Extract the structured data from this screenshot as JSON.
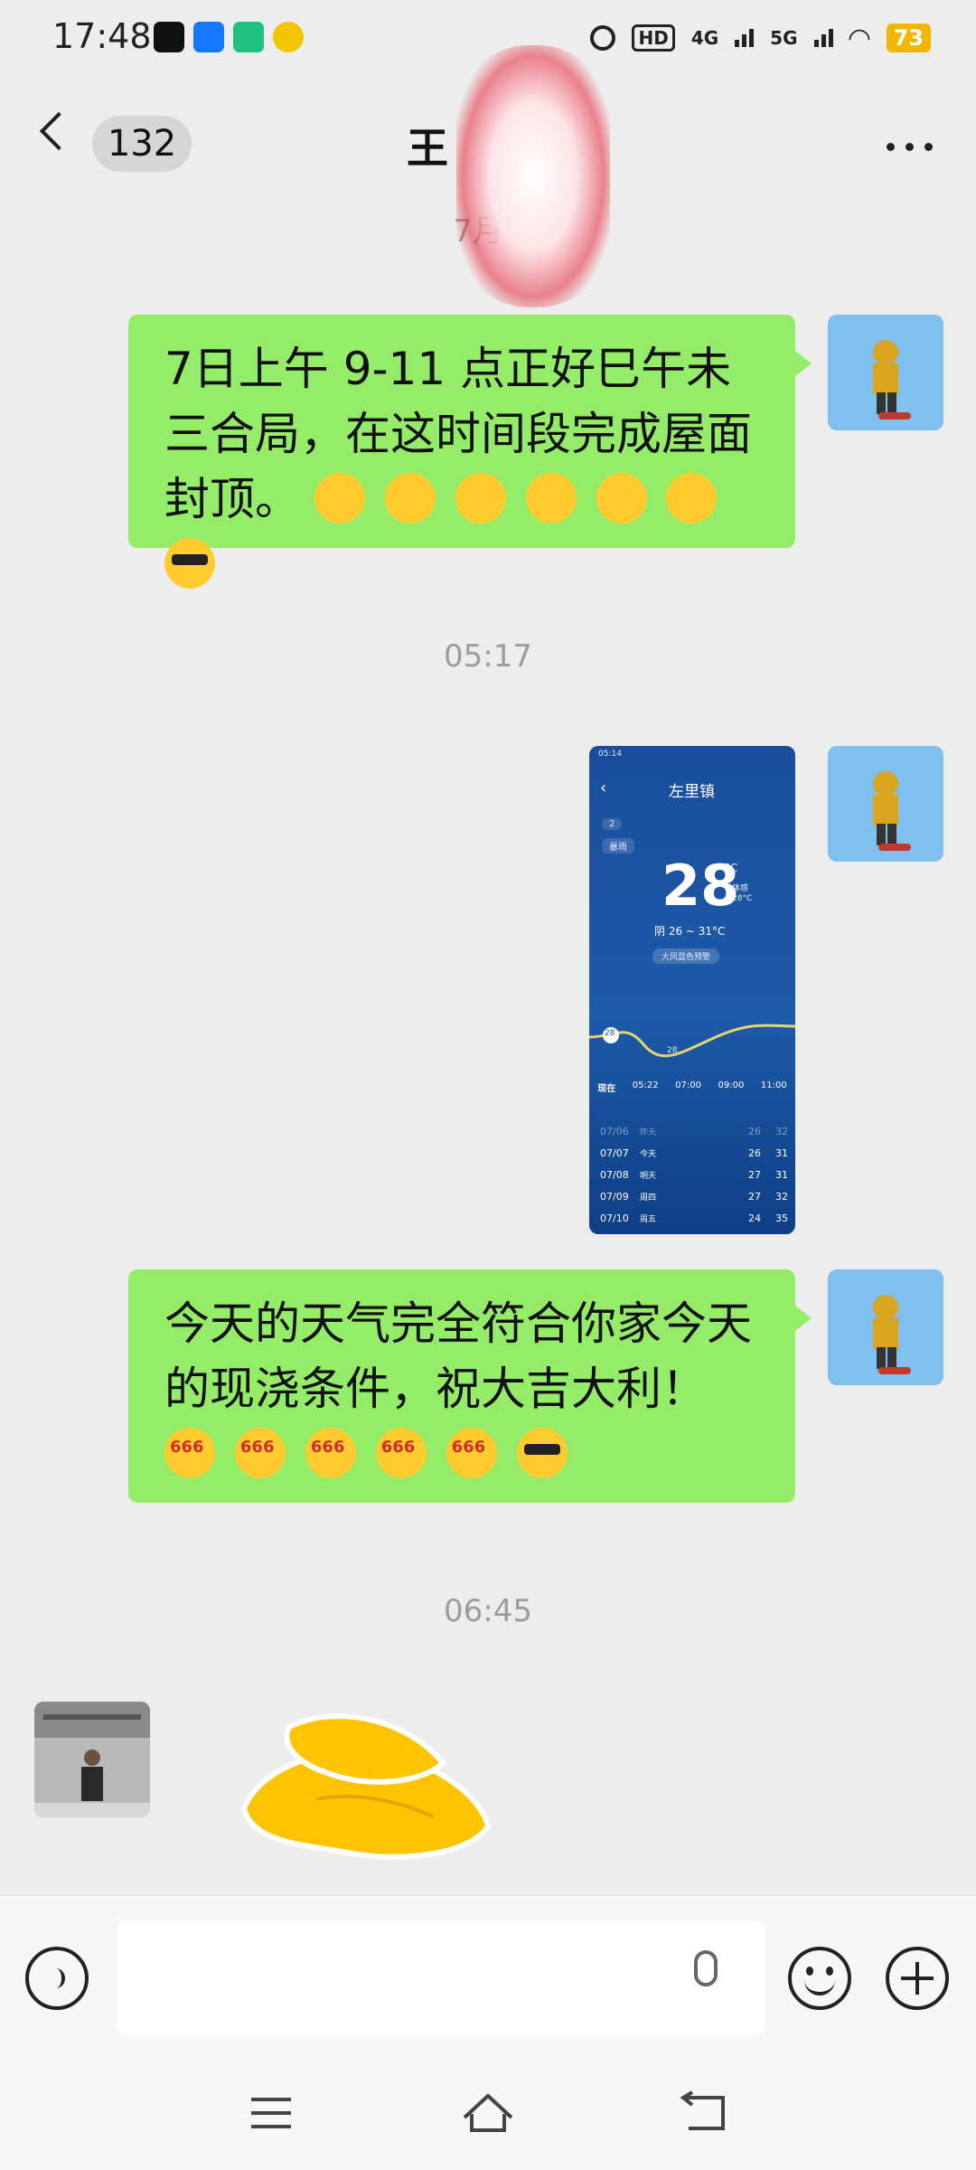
{
  "status_bar": {
    "time": "17:48",
    "network_1": "4G",
    "network_2": "5G",
    "battery": "73",
    "hd_label": "HD"
  },
  "header": {
    "unread_count": "132",
    "title": "王"
  },
  "messages": [
    {
      "type": "timestamp",
      "text": "7月4"
    },
    {
      "type": "text",
      "from": "me",
      "text": "7日上午 9-11 点正好巳午未三合局，在这时间段完成屋面封顶。"
    },
    {
      "type": "timestamp",
      "text": "05:17"
    },
    {
      "type": "image",
      "from": "me"
    },
    {
      "type": "text",
      "from": "me",
      "text": "今天的天气完全符合你家今天的现浇条件，祝大吉大利！"
    },
    {
      "type": "timestamp",
      "text": "06:45"
    },
    {
      "type": "sticker",
      "from": "other"
    }
  ],
  "weather_screenshot": {
    "status_time": "05:14",
    "location": "左里镇",
    "chip_1": "2",
    "chip_2": "暴雨",
    "temp": "28",
    "unit": "°C",
    "feels_label": "体感",
    "feels_value": "28°C",
    "condition": "阴  26 ~ 31°C",
    "alert": "大风蓝色预警",
    "curve_label_1": "28",
    "curve_label_2": "28",
    "hours": [
      "现在",
      "05:22",
      "07:00",
      "09:00",
      "11:00"
    ],
    "days": [
      {
        "date": "07/06",
        "day": "昨天",
        "low": "26",
        "high": "32"
      },
      {
        "date": "07/07",
        "day": "今天",
        "low": "26",
        "high": "31"
      },
      {
        "date": "07/08",
        "day": "明天",
        "low": "27",
        "high": "31"
      },
      {
        "date": "07/09",
        "day": "周四",
        "low": "27",
        "high": "32"
      },
      {
        "date": "07/10",
        "day": "周五",
        "low": "24",
        "high": "35"
      }
    ]
  },
  "emoji_666_label": "666",
  "colors": {
    "bubble_green": "#95ec69",
    "background": "#ededed",
    "timestamp_gray": "#9c9c9c",
    "battery_yellow": "#f2b600"
  },
  "icons": {
    "back": "chevron-left-icon",
    "more": "more-horizontal-icon",
    "voice": "voice-icon",
    "mic": "microphone-icon",
    "emoji": "smiley-icon",
    "plus": "plus-icon"
  }
}
